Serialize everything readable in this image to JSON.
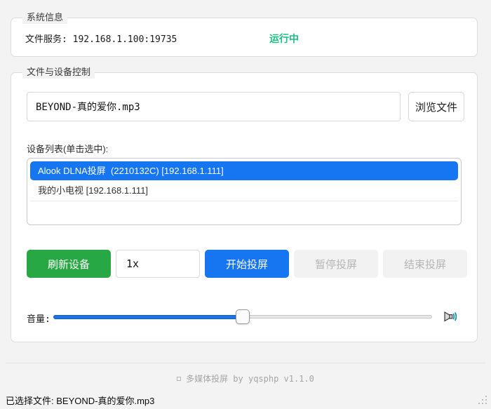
{
  "colors": {
    "accent_blue": "#1676f2",
    "success_green": "#28a745",
    "running_green": "#1fbe83",
    "window_bg": "#f3f3f3",
    "disabled_bg": "#f2f2f2"
  },
  "system_info": {
    "group_title": "系统信息",
    "file_service_line": "文件服务: 192.168.1.100:19735",
    "status_text": "运行中"
  },
  "file_device": {
    "group_title": "文件与设备控制",
    "file_input_value": "BEYOND-真的爱你.mp3",
    "browse_button_label": "浏览文件",
    "device_list_label": "设备列表(单击选中):",
    "devices": [
      {
        "label": "Alook DLNA投屏  (2210132C) [192.168.1.111]",
        "selected": true
      },
      {
        "label": "我的小电视 [192.168.1.111]",
        "selected": false
      }
    ],
    "refresh_button_label": "刷新设备",
    "rate_input_value": "1x",
    "start_button_label": "开始投屏",
    "pause_button_label": "暂停投屏",
    "stop_button_label": "结束投屏",
    "volume_label": "音量:",
    "volume_percent": 50,
    "speaker_icon": "speaker-icon"
  },
  "footer": {
    "credit_text": "多媒体投屏 by yqsphp v1.1.0"
  },
  "status_bar": {
    "selected_file_text": "已选择文件: BEYOND-真的爱你.mp3"
  }
}
